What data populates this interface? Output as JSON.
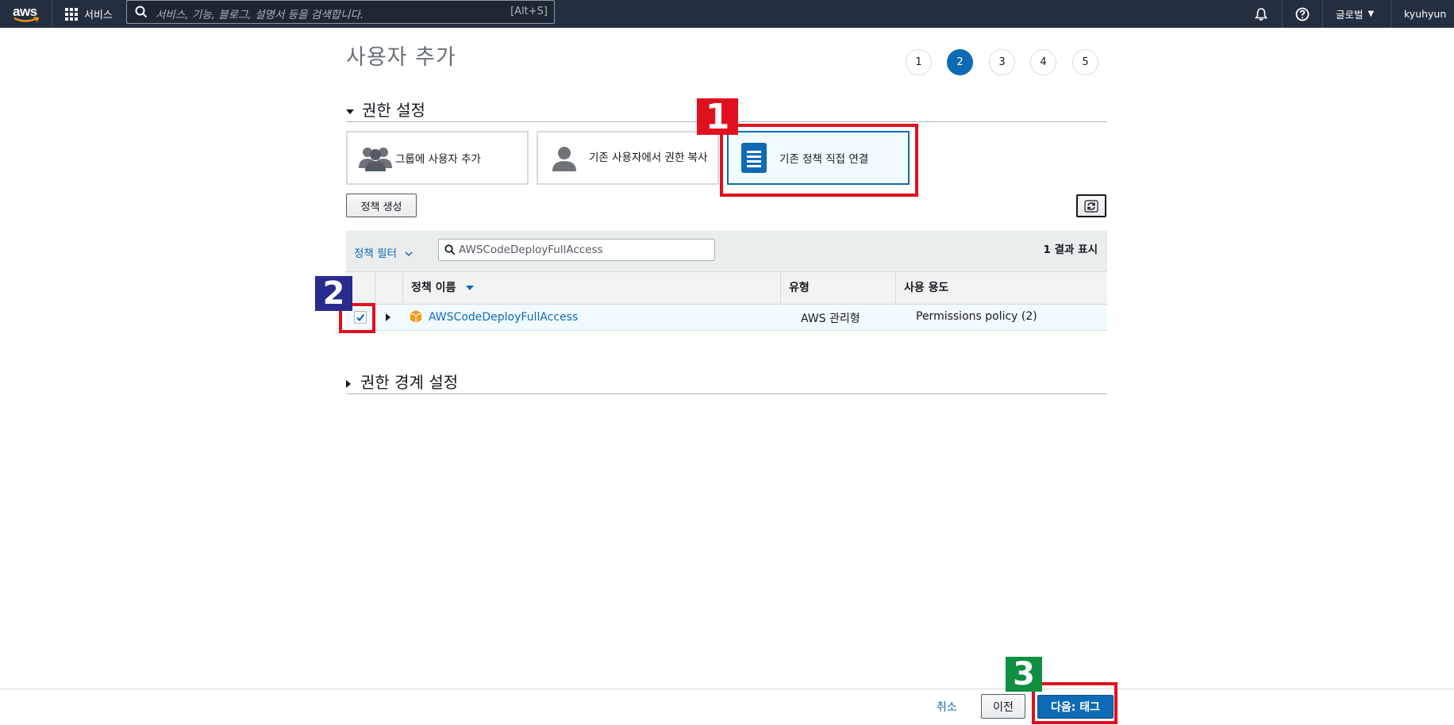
{
  "nav": {
    "logo": "aws",
    "services_label": "서비스",
    "search_placeholder": "서비스, 기능, 블로그, 설명서 등을 검색합니다.",
    "search_hotkey": "[Alt+S]",
    "region_label": "글로벌",
    "user_label": "kyuhyun"
  },
  "page": {
    "title": "사용자 추가"
  },
  "steps": [
    {
      "label": "1",
      "active": false
    },
    {
      "label": "2",
      "active": true
    },
    {
      "label": "3",
      "active": false
    },
    {
      "label": "4",
      "active": false
    },
    {
      "label": "5",
      "active": false
    }
  ],
  "permissions": {
    "section_title": "권한 설정",
    "options": [
      {
        "label": "그룹에 사용자 추가",
        "icon": "users-group-icon",
        "selected": false
      },
      {
        "label": "기존 사용자에서 권한 복사",
        "icon": "user-icon",
        "selected": false
      },
      {
        "label": "기존 정책 직접 연결",
        "icon": "document-icon",
        "selected": true
      }
    ],
    "create_policy_label": "정책 생성",
    "refresh_icon": "refresh-icon"
  },
  "table": {
    "filter_label": "정책 필터",
    "filter_value": "AWSCodeDeployFullAccess",
    "result_count": "1 결과 표시",
    "headers": {
      "name": "정책 이름",
      "type": "유형",
      "usage": "사용 용도"
    },
    "rows": [
      {
        "name": "AWSCodeDeployFullAccess",
        "type": "AWS 관리형",
        "usage": "Permissions policy (2)",
        "checked": true
      }
    ]
  },
  "boundary": {
    "section_title": "권한 경계 설정"
  },
  "footer": {
    "cancel_label": "취소",
    "previous_label": "이전",
    "next_label": "다음: 태그"
  },
  "callouts": [
    {
      "number": "1",
      "color": "#e0101e"
    },
    {
      "number": "2",
      "color": "#2a2b8f"
    },
    {
      "number": "3",
      "color": "#0f8f3f"
    }
  ]
}
